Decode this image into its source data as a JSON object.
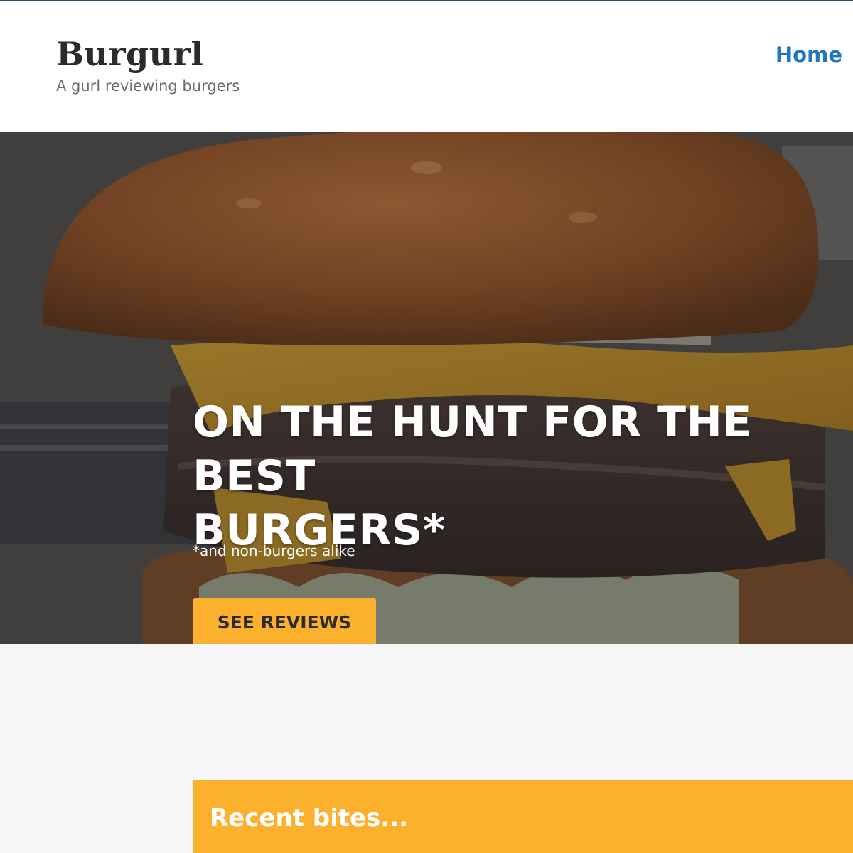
{
  "header": {
    "site_title": "Burgurl",
    "tagline": "A gurl reviewing burgers"
  },
  "nav": {
    "items": [
      {
        "label": "Home"
      }
    ]
  },
  "hero": {
    "title": "ON THE HUNT FOR THE BEST\nBURGERS*",
    "subtitle": "*and non-burgers alike",
    "cta_label": "SEE REVIEWS",
    "image": "burger-photo"
  },
  "recent": {
    "title": "Recent bites..."
  },
  "colors": {
    "accent": "#fbb12e",
    "link": "#1f77b8",
    "header_bg": "#ffffff",
    "page_bg": "#f6f6f6",
    "title_text": "#2b2b2b"
  }
}
